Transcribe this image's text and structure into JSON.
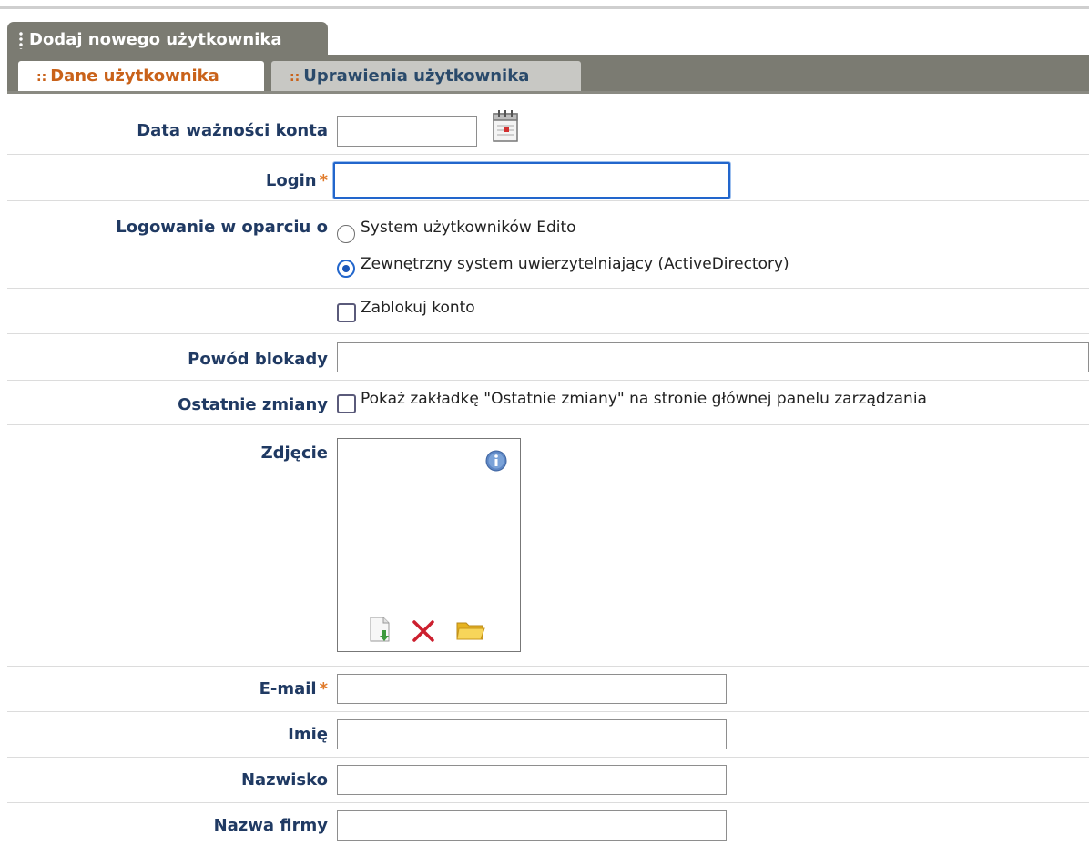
{
  "window": {
    "title": "Dodaj nowego użytkownika"
  },
  "tabs": [
    {
      "label": "Dane użytkownika",
      "active": true
    },
    {
      "label": "Uprawienia użytkownika",
      "active": false
    }
  ],
  "tab_marker": "::",
  "form": {
    "expiry": {
      "label": "Data ważności konta",
      "value": "",
      "icon": "calendar-icon"
    },
    "login": {
      "label": "Login",
      "required_mark": "*",
      "value": ""
    },
    "auth": {
      "label": "Logowanie w oparciu o",
      "options": [
        {
          "label": "System użytkowników Edito",
          "selected": false
        },
        {
          "label": "Zewnętrzny system uwierzytelniający (ActiveDirectory)",
          "selected": true
        }
      ]
    },
    "block": {
      "label": "Zablokuj konto",
      "checked": false
    },
    "block_reason": {
      "label": "Powód blokady",
      "value": ""
    },
    "recent": {
      "label": "Ostatnie zmiany",
      "checkbox_label": "Pokaż zakładkę \"Ostatnie zmiany\" na stronie głównej panelu zarządzania",
      "checked": false
    },
    "photo": {
      "label": "Zdjęcie",
      "icons": [
        "info-icon",
        "upload-icon",
        "delete-icon",
        "browse-folder-icon"
      ]
    },
    "email": {
      "label": "E-mail",
      "required_mark": "*",
      "value": ""
    },
    "first_name": {
      "label": "Imię",
      "value": ""
    },
    "last_name": {
      "label": "Nazwisko",
      "value": ""
    },
    "company": {
      "label": "Nazwa firmy",
      "value": ""
    }
  },
  "colors": {
    "tab_bar": "#7b7b72",
    "active_tab_text": "#c9621a",
    "label_text": "#203a63",
    "required": "#e07a2a",
    "focus_border": "#2266cc"
  }
}
